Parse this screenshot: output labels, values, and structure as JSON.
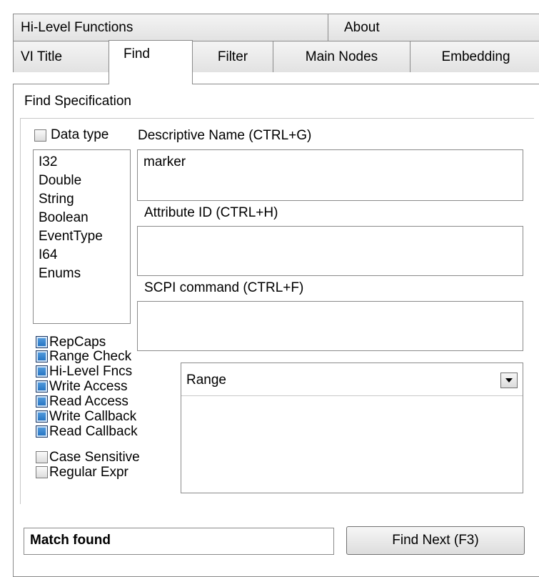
{
  "tabs_top": [
    {
      "label": "Hi-Level Functions"
    },
    {
      "label": "About"
    }
  ],
  "tabs_bottom": [
    {
      "label": "VI Title"
    },
    {
      "label": "Find",
      "active": true
    },
    {
      "label": "Filter"
    },
    {
      "label": "Main Nodes"
    },
    {
      "label": "Embedding"
    }
  ],
  "find": {
    "section_title": "Find Specification",
    "data_type": {
      "checkbox_label": "Data type",
      "checked": false,
      "options": [
        "I32",
        "Double",
        "String",
        "Boolean",
        "EventType",
        "I64",
        "Enums"
      ]
    },
    "descriptive_name": {
      "label": "Descriptive Name (CTRL+G)",
      "value": "marker"
    },
    "attribute_id": {
      "label": "Attribute ID (CTRL+H)",
      "value": ""
    },
    "scpi_command": {
      "label": "SCPI command (CTRL+F)",
      "value": ""
    },
    "flags": [
      {
        "label": "RepCaps",
        "checked": true
      },
      {
        "label": "Range Check",
        "checked": true
      },
      {
        "label": "Hi-Level Fncs",
        "checked": true
      },
      {
        "label": "Write Access",
        "checked": true
      },
      {
        "label": "Read Access",
        "checked": true
      },
      {
        "label": "Write Callback",
        "checked": true
      },
      {
        "label": "Read Callback",
        "checked": true
      }
    ],
    "options": [
      {
        "label": "Case Sensitive",
        "checked": false
      },
      {
        "label": "Regular Expr",
        "checked": false
      }
    ],
    "range_select": {
      "value": "Range"
    },
    "status_text": "Match found",
    "find_next_label": "Find Next (F3)"
  },
  "colors": {
    "checked_fill": "#1f6fbf",
    "border": "#8a8a8a",
    "tab_bg": "#e8e8e8"
  }
}
